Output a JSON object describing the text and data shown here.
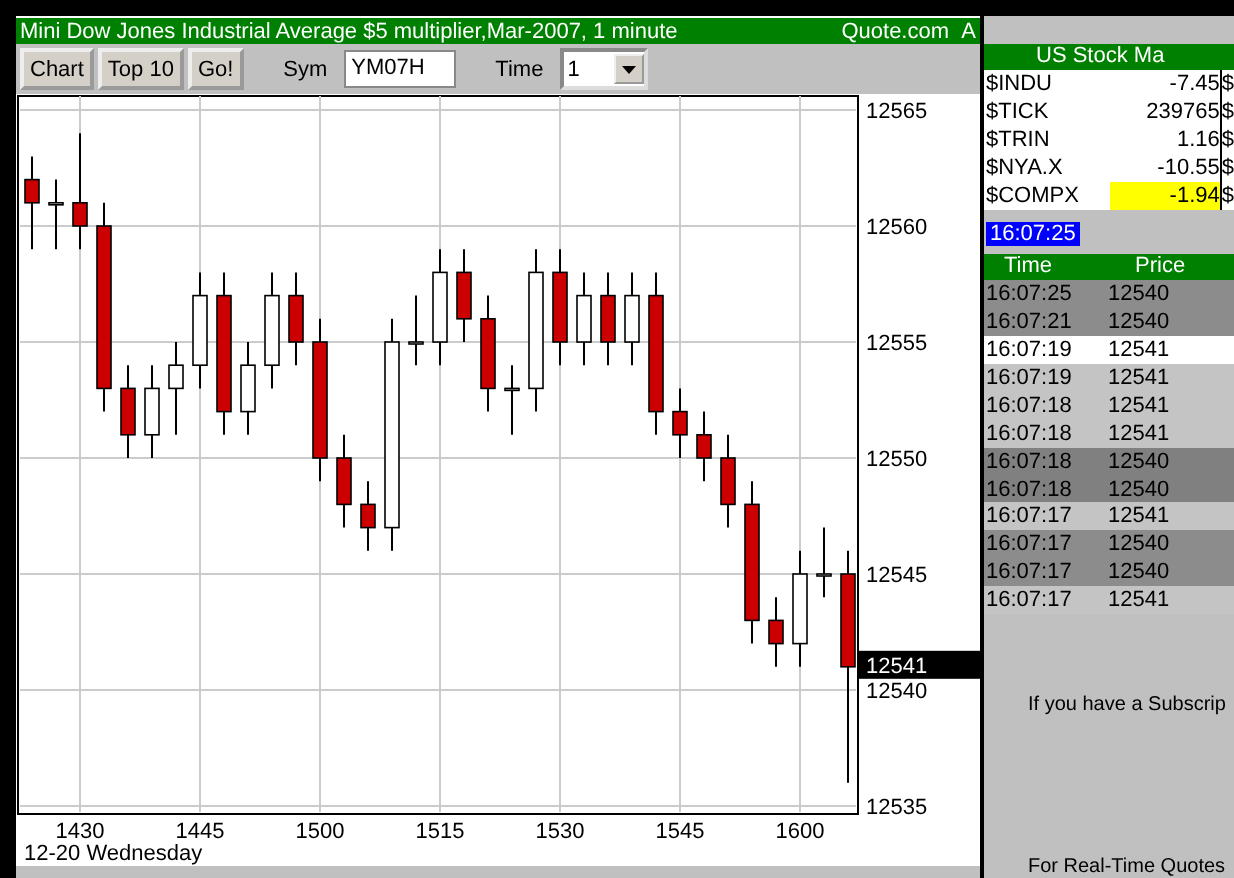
{
  "window": {
    "title": "Mini Dow Jones Industrial Average $5 multiplier,Mar-2007, 1 minute",
    "source": "Quote.com",
    "source_suffix": "A"
  },
  "toolbar": {
    "buttons": [
      "Chart",
      "Top 10",
      "Go!"
    ],
    "symbol_label": "Sym",
    "symbol_value": "YM07H",
    "time_label": "Time",
    "time_value": "1"
  },
  "chart": {
    "current_price": "12541",
    "date_label": "12-20 Wednesday",
    "chart_data": {
      "type": "candlestick",
      "grid": true,
      "ylim": [
        12535,
        12565
      ],
      "yticks": [
        12535,
        12540,
        12545,
        12550,
        12555,
        12560,
        12565
      ],
      "categories": [
        null,
        null,
        "1430",
        null,
        null,
        null,
        null,
        "1445",
        null,
        null,
        null,
        null,
        "1500",
        null,
        null,
        null,
        null,
        "1515",
        null,
        null,
        null,
        null,
        "1530",
        null,
        null,
        null,
        null,
        "1545",
        null,
        null,
        null,
        null,
        "1600",
        null,
        null
      ],
      "ohlc": [
        [
          12562,
          12563,
          12559,
          12561
        ],
        [
          12561,
          12562,
          12559,
          12561
        ],
        [
          12561,
          12564,
          12559,
          12560
        ],
        [
          12560,
          12561,
          12552,
          12553
        ],
        [
          12553,
          12554,
          12550,
          12551
        ],
        [
          12551,
          12554,
          12550,
          12553
        ],
        [
          12553,
          12555,
          12551,
          12554
        ],
        [
          12554,
          12558,
          12553,
          12557
        ],
        [
          12557,
          12558,
          12551,
          12552
        ],
        [
          12552,
          12555,
          12551,
          12554
        ],
        [
          12554,
          12558,
          12553,
          12557
        ],
        [
          12557,
          12558,
          12554,
          12555
        ],
        [
          12555,
          12556,
          12549,
          12550
        ],
        [
          12550,
          12551,
          12547,
          12548
        ],
        [
          12548,
          12549,
          12546,
          12547
        ],
        [
          12547,
          12556,
          12546,
          12555
        ],
        [
          12555,
          12557,
          12554,
          12555
        ],
        [
          12555,
          12559,
          12554,
          12558
        ],
        [
          12558,
          12559,
          12555,
          12556
        ],
        [
          12556,
          12557,
          12552,
          12553
        ],
        [
          12553,
          12554,
          12551,
          12553
        ],
        [
          12553,
          12559,
          12552,
          12558
        ],
        [
          12558,
          12559,
          12554,
          12555
        ],
        [
          12555,
          12558,
          12554,
          12557
        ],
        [
          12557,
          12558,
          12554,
          12555
        ],
        [
          12555,
          12558,
          12554,
          12557
        ],
        [
          12557,
          12558,
          12551,
          12552
        ],
        [
          12552,
          12553,
          12550,
          12551
        ],
        [
          12551,
          12552,
          12549,
          12550
        ],
        [
          12550,
          12551,
          12547,
          12548
        ],
        [
          12548,
          12549,
          12542,
          12543
        ],
        [
          12543,
          12544,
          12541,
          12542
        ],
        [
          12542,
          12546,
          12541,
          12545
        ],
        [
          12545,
          12547,
          12544,
          12545
        ],
        [
          12545,
          12546,
          12536,
          12541
        ]
      ]
    }
  },
  "market": {
    "title": "US Stock Ma",
    "rows": [
      {
        "symbol": "$INDU",
        "value": "-7.45",
        "column_3": "$",
        "highlighted": false
      },
      {
        "symbol": "$TICK",
        "value": "239765",
        "column_3": "$",
        "highlighted": false
      },
      {
        "symbol": "$TRIN",
        "value": "1.16",
        "column_3": "$",
        "highlighted": false
      },
      {
        "symbol": "$NYA.X",
        "value": "-10.55",
        "column_3": "$",
        "highlighted": false
      },
      {
        "symbol": "$COMPX",
        "value": "-1.94",
        "column_3": "$",
        "highlighted": true
      }
    ]
  },
  "last_update": "16:07:25",
  "trades": {
    "columns": [
      "Time",
      "Price"
    ],
    "rows": [
      {
        "time": "16:07:25",
        "price": "12540",
        "color": "#8c8c8c"
      },
      {
        "time": "16:07:21",
        "price": "12540",
        "color": "#8c8c8c"
      },
      {
        "time": "16:07:19",
        "price": "12541",
        "color": "#ffffff"
      },
      {
        "time": "16:07:19",
        "price": "12541",
        "color": "#c4c4c4"
      },
      {
        "time": "16:07:18",
        "price": "12541",
        "color": "#c4c4c4"
      },
      {
        "time": "16:07:18",
        "price": "12541",
        "color": "#c4c4c4"
      },
      {
        "time": "16:07:18",
        "price": "12540",
        "color": "#808080"
      },
      {
        "time": "16:07:18",
        "price": "12540",
        "color": "#808080"
      },
      {
        "time": "16:07:17",
        "price": "12541",
        "color": "#c4c4c4"
      },
      {
        "time": "16:07:17",
        "price": "12540",
        "color": "#8c8c8c"
      },
      {
        "time": "16:07:17",
        "price": "12540",
        "color": "#8c8c8c"
      },
      {
        "time": "16:07:17",
        "price": "12541",
        "color": "#c4c4c4"
      }
    ]
  },
  "notices": [
    "If you have a Subscrip",
    "For Real-Time Quotes"
  ]
}
